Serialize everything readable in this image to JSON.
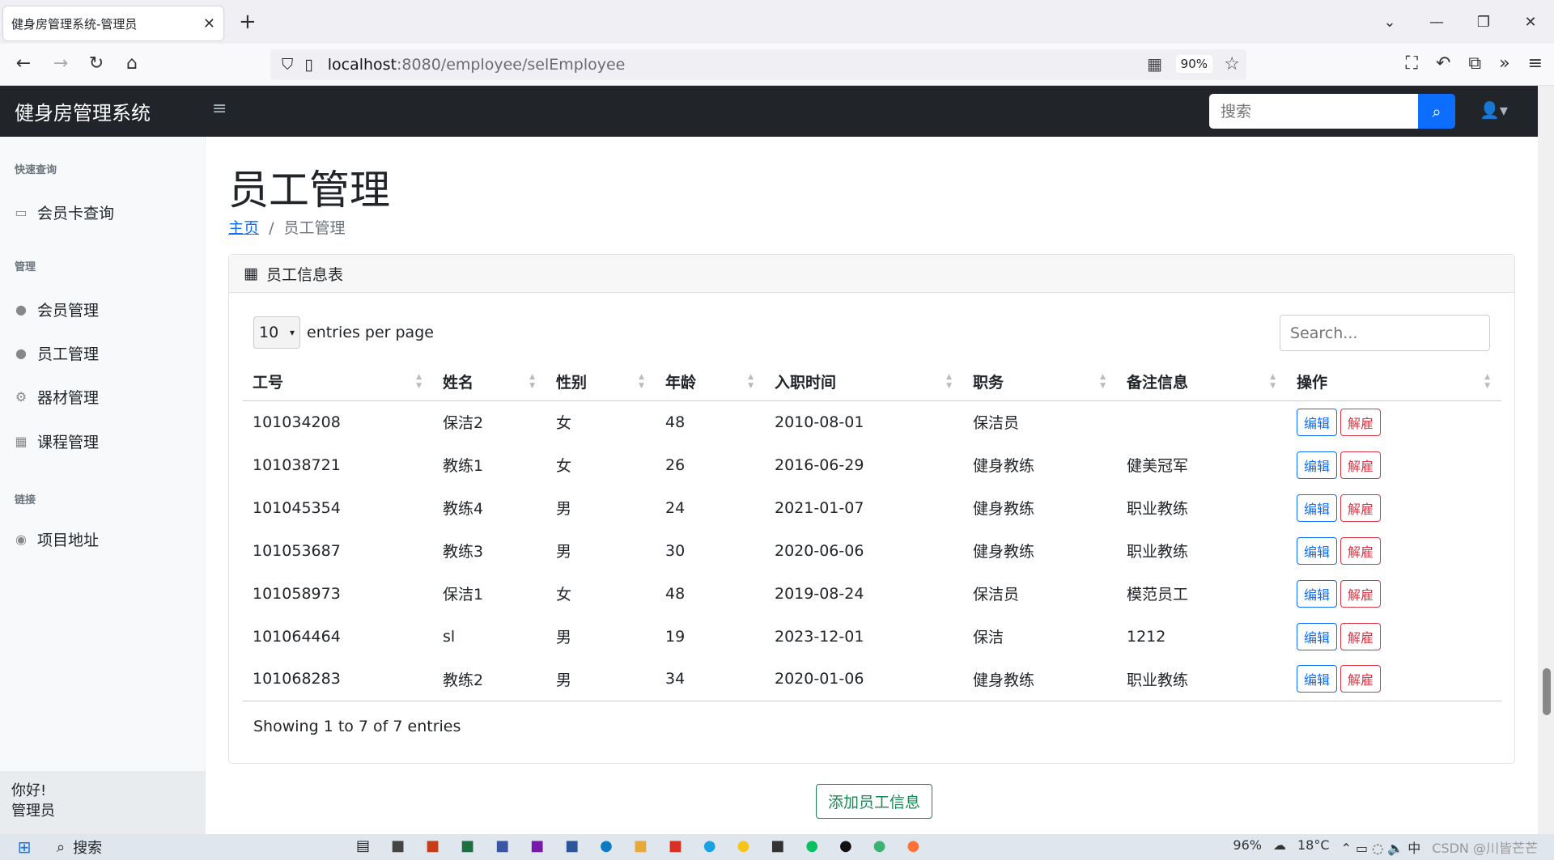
{
  "browser": {
    "tab_title": "健身房管理系统-管理员",
    "url_host": "localhost",
    "url_rest": ":8080/employee/selEmployee",
    "zoom": "90%"
  },
  "app": {
    "brand": "健身房管理系统",
    "search_placeholder": "搜索"
  },
  "sidebar": {
    "headings": [
      "快速查询",
      "管理",
      "链接"
    ],
    "items": [
      {
        "label": "会员卡查询",
        "icon": "id-card-icon"
      },
      {
        "label": "会员管理",
        "icon": "user-icon"
      },
      {
        "label": "员工管理",
        "icon": "user-icon"
      },
      {
        "label": "器材管理",
        "icon": "equipment-icon"
      },
      {
        "label": "课程管理",
        "icon": "calendar-icon"
      },
      {
        "label": "项目地址",
        "icon": "github-icon"
      }
    ],
    "footer_greeting": "你好!",
    "footer_user": "管理员"
  },
  "main": {
    "title": "员工管理",
    "breadcrumb_home": "主页",
    "breadcrumb_sep": "/",
    "breadcrumb_current": "员工管理",
    "card_title": "员工信息表",
    "per_page_value": "10",
    "per_page_label": "entries per page",
    "table_search_placeholder": "Search...",
    "columns": [
      "工号",
      "姓名",
      "性别",
      "年龄",
      "入职时间",
      "职务",
      "备注信息",
      "操作"
    ],
    "rows": [
      [
        "101034208",
        "保洁2",
        "女",
        "48",
        "2010-08-01",
        "保洁员",
        ""
      ],
      [
        "101038721",
        "教练1",
        "女",
        "26",
        "2016-06-29",
        "健身教练",
        "健美冠军"
      ],
      [
        "101045354",
        "教练4",
        "男",
        "24",
        "2021-01-07",
        "健身教练",
        "职业教练"
      ],
      [
        "101053687",
        "教练3",
        "男",
        "30",
        "2020-06-06",
        "健身教练",
        "职业教练"
      ],
      [
        "101058973",
        "保洁1",
        "女",
        "48",
        "2019-08-24",
        "保洁员",
        "模范员工"
      ],
      [
        "101064464",
        "sl",
        "男",
        "19",
        "2023-12-01",
        "保洁",
        "1212"
      ],
      [
        "101068283",
        "教练2",
        "男",
        "34",
        "2020-01-06",
        "健身教练",
        "职业教练"
      ]
    ],
    "edit_label": "编辑",
    "fire_label": "解雇",
    "info": "Showing 1 to 7 of 7 entries",
    "add_label": "添加员工信息"
  },
  "taskbar": {
    "search_label": "搜索",
    "temperature": "18°C",
    "battery": "96%",
    "watermark": "CSDN @川皆芒芒"
  }
}
